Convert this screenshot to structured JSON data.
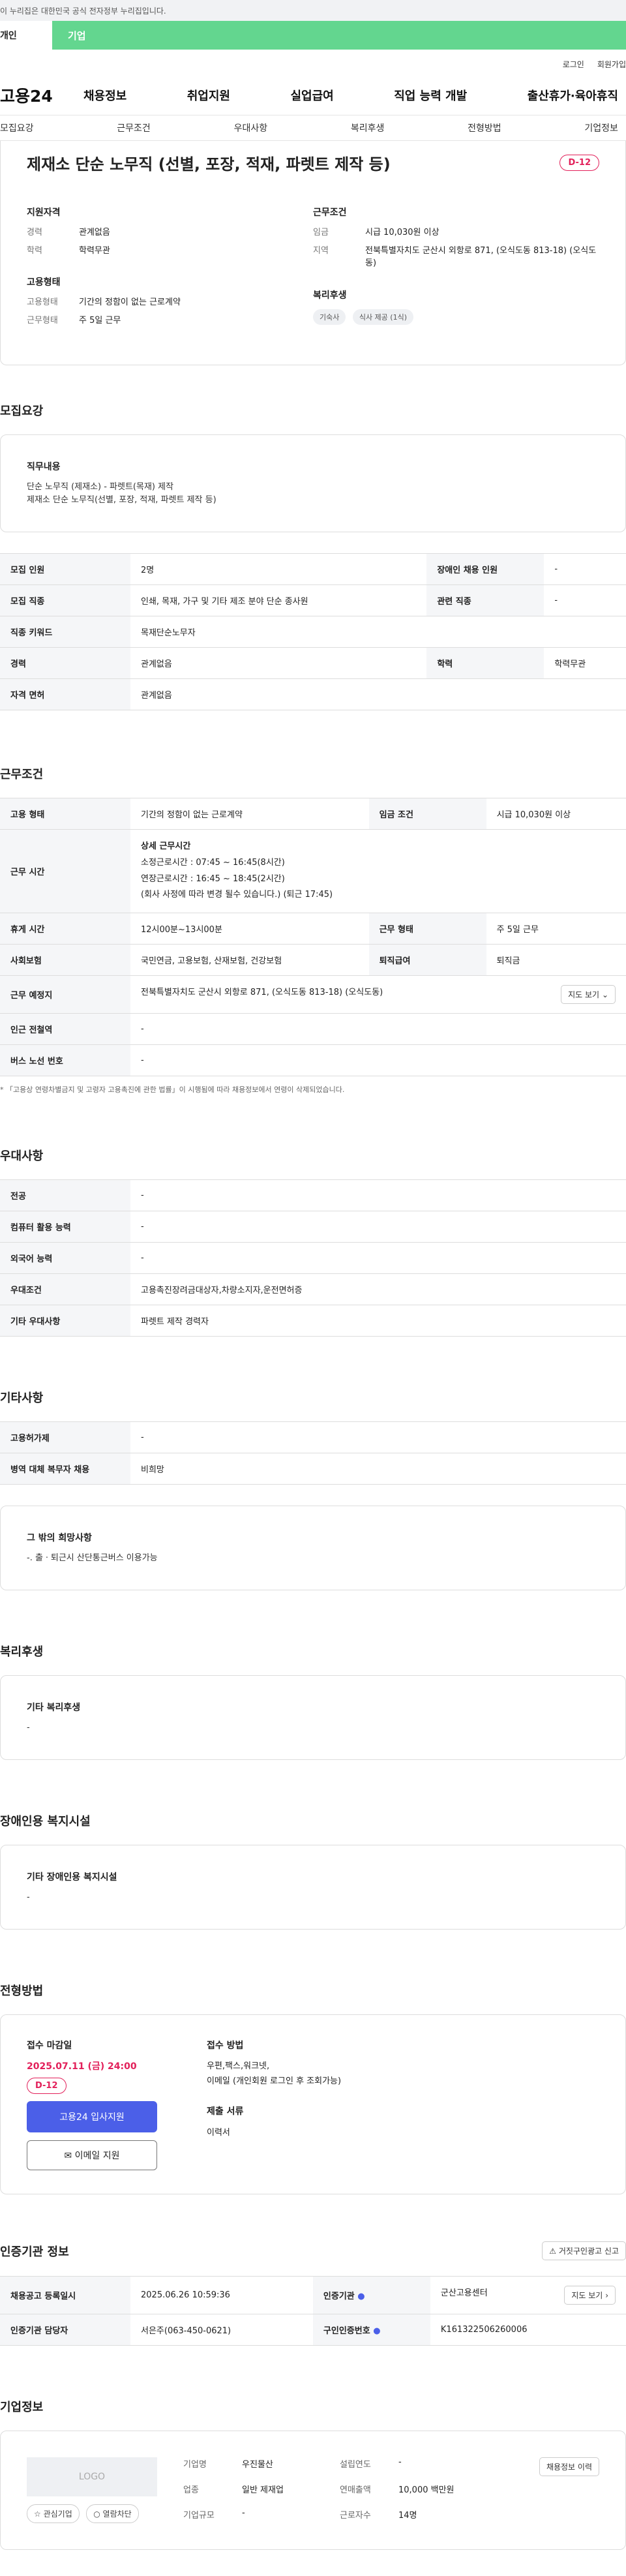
{
  "gov_notice": "이 누리집은 대한민국 공식 전자정부 누리집입니다.",
  "user_tabs": {
    "person": "개인",
    "corp": "기업"
  },
  "util_links": {
    "login": "로그인",
    "signup": "회원가입"
  },
  "gnb": {
    "logo": "고용24",
    "menus": [
      "채용정보",
      "취업지원",
      "실업급여",
      "직업 능력 개발",
      "출산휴가·육아휴직"
    ]
  },
  "sub_tabs": [
    "모집요강",
    "근무조건",
    "우대사항",
    "복리후생",
    "전형방법",
    "기업정보"
  ],
  "summary": {
    "title": "제재소 단순 노무직 (선별, 포장, 적재, 파렛트 제작 등)",
    "dday": "D-12",
    "qual_title": "지원자격",
    "qual": [
      {
        "k": "경력",
        "v": "관계없음"
      },
      {
        "k": "학력",
        "v": "학력무관"
      }
    ],
    "emp_title": "고용형태",
    "emp": [
      {
        "k": "고용형태",
        "v": "기간의 정함이 없는 근로계약"
      },
      {
        "k": "근무형태",
        "v": "주 5일 근무"
      }
    ],
    "cond_title": "근무조건",
    "cond": [
      {
        "k": "임금",
        "v": "시급 10,030원 이상"
      },
      {
        "k": "지역",
        "v": "전북특별자치도 군산시 외항로 871, (오식도동 813-18) (오식도동)"
      }
    ],
    "welfare_title": "복리후생",
    "welfare_chips": [
      "기숙사",
      "식사 제공 (1식)"
    ]
  },
  "recruit": {
    "section_title": "모집요강",
    "duty_title": "직무내용",
    "duty_lines": [
      "단순 노무직 (제재소) -  파렛트(목재) 제작",
      "제재소 단순 노무직(선별, 포장, 적재, 파렛트 제작 등)"
    ],
    "table": [
      {
        "k1": "모집 인원",
        "v1": "2명",
        "k2": "장애인 채용 인원",
        "v2": "-"
      },
      {
        "k1": "모집 직종",
        "v1": "인쇄, 목재, 가구 및 기타 제조 분야 단순 종사원",
        "k2": "관련 직종",
        "v2": "-"
      },
      {
        "k1": "직종 키워드",
        "v1": "목재단순노무자"
      },
      {
        "k1": "경력",
        "v1": "관계없음",
        "k2": "학력",
        "v2": "학력무관"
      },
      {
        "k1": "자격 면허",
        "v1": "관계없음"
      }
    ]
  },
  "work": {
    "section_title": "근무조건",
    "emp_type_k": "고용 형태",
    "emp_type_v": "기간의 정함이 없는 근로계약",
    "wage_k": "임금 조건",
    "wage_v": "시급 10,030원 이상",
    "hours_k": "근무 시간",
    "hours_title": "상세 근무시간",
    "hours_lines": [
      "소정근로시간 : 07:45 ~ 16:45(8시간)",
      "연장근로시간 : 16:45 ~ 18:45(2시간)",
      "(회사 사정에 따라 변경 될수 있습니다.) (퇴근 17:45)"
    ],
    "break_k": "휴게 시간",
    "break_v": "12시00분~13시00분",
    "form_k": "근무 형태",
    "form_v": "주 5일 근무",
    "insure_k": "사회보험",
    "insure_v": "국민연금, 고용보험, 산재보험, 건강보험",
    "retire_k": "퇴직급여",
    "retire_v": "퇴직금",
    "place_k": "근무 예정지",
    "place_v": "전북특별자치도 군산시 외항로 871, (오식도동 813-18) (오식도동)",
    "map_btn": "지도 보기",
    "station_k": "인근 전철역",
    "station_v": "-",
    "bus_k": "버스 노선 번호",
    "bus_v": "-",
    "note": "* 「고용상 연령차별금지 및 고령자 고용촉진에 관한 법률」이 시행됨에 따라 채용정보에서 연령이 삭제되었습니다."
  },
  "prefer": {
    "section_title": "우대사항",
    "rows": [
      {
        "k": "전공",
        "v": "-"
      },
      {
        "k": "컴퓨터 활용 능력",
        "v": "-"
      },
      {
        "k": "외국어 능력",
        "v": "-"
      },
      {
        "k": "우대조건",
        "v": "고용촉진장려금대상자,차량소지자,운전면허증"
      },
      {
        "k": "기타 우대사항",
        "v": "파렛트 제작 경력자"
      }
    ]
  },
  "etc": {
    "section_title": "기타사항",
    "rows": [
      {
        "k": "고용허가제",
        "v": "-"
      },
      {
        "k": "병역 대체 복무자 채용",
        "v": "비희망"
      }
    ],
    "other_title": "그 밖의 희망사항",
    "other_text": "-. 출ㆍ퇴근시 산단통근버스 이용가능"
  },
  "welfare": {
    "section_title": "복리후생",
    "box_title": "기타 복리후생",
    "box_text": "-"
  },
  "disabled": {
    "section_title": "장애인용 복지시설",
    "box_title": "기타 장애인용 복지시설",
    "box_text": "-"
  },
  "apply": {
    "section_title": "전형방법",
    "deadline_title": "접수 마감일",
    "deadline": "2025.07.11 (금) 24:00",
    "dday": "D-12",
    "apply_btn": "고용24 입사지원",
    "email_btn": "이메일 지원",
    "method_title": "접수 방법",
    "method_lines": [
      "우편,팩스,워크넷,",
      "이메일 (개인회원 로그인 후 조회가능)"
    ],
    "docs_title": "제출 서류",
    "docs": "이력서"
  },
  "cert": {
    "section_title": "인증기관 정보",
    "report_btn": "거짓구인광고 신고",
    "reg_k": "채용공고 등록일시",
    "reg_v": "2025.06.26 10:59:36",
    "org_k": "인증기관",
    "org_v": "군산고용센터",
    "org_btn": "지도 보기",
    "mgr_k": "인증기관 담당자",
    "mgr_v": "서은주(063-450-0621)",
    "no_k": "구인인증번호",
    "no_v": "K161322506260006"
  },
  "company": {
    "section_title": "기업정보",
    "logo": "LOGO",
    "fav_btn": "관심기업",
    "block_btn": "열람차단",
    "history_btn": "채용정보 이력",
    "fields": [
      {
        "k": "기업명",
        "v": "우진물산"
      },
      {
        "k": "설립연도",
        "v": "-"
      },
      {
        "k": "업종",
        "v": "일반 제재업"
      },
      {
        "k": "연매출액",
        "v": "10,000 백만원"
      },
      {
        "k": "기업규모",
        "v": "-"
      },
      {
        "k": "근로자수",
        "v": "14명"
      }
    ]
  }
}
